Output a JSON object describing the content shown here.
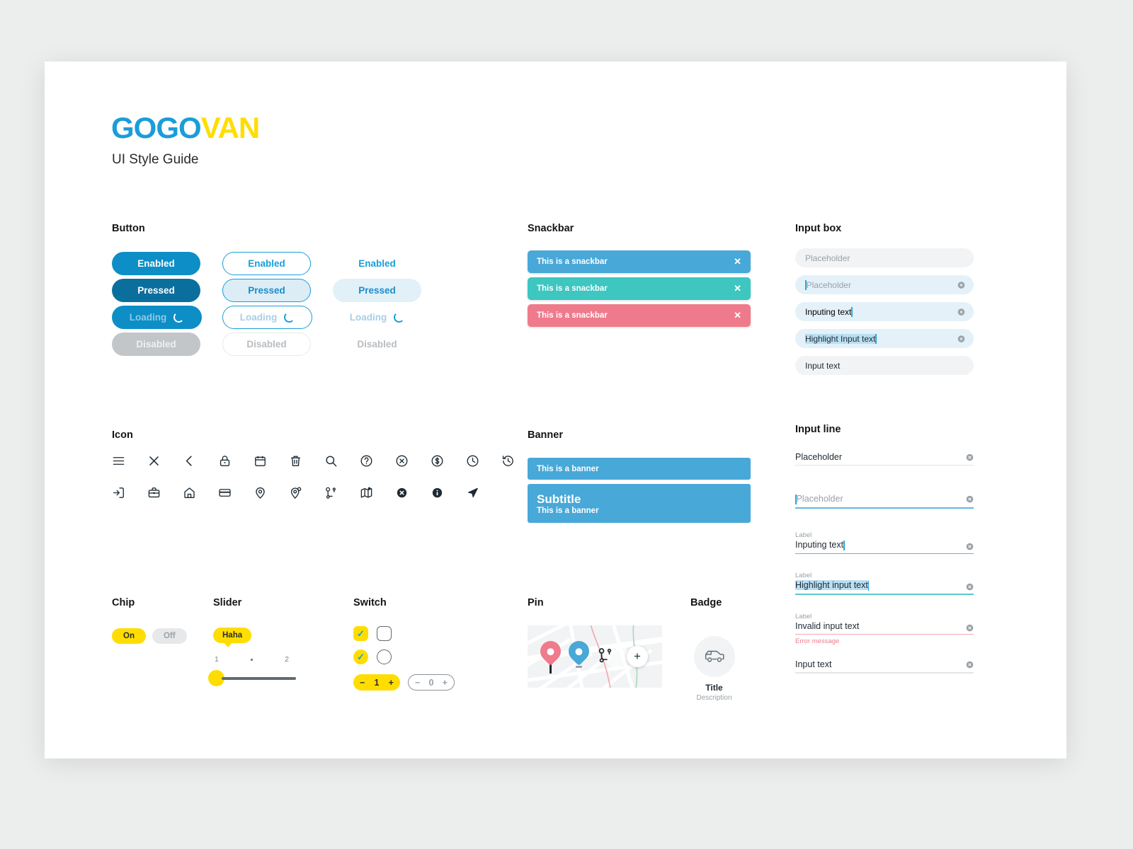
{
  "brand": {
    "part1": "GOGO",
    "part2": "VAN",
    "subtitle": "UI Style Guide",
    "blue": "#1b9dd9",
    "yellow": "#ffdd00"
  },
  "sections": {
    "button": "Button",
    "snackbar": "Snackbar",
    "input_box": "Input box",
    "icon": "Icon",
    "banner": "Banner",
    "input_line": "Input line",
    "chip": "Chip",
    "slider": "Slider",
    "switch": "Switch",
    "pin": "Pin",
    "badge": "Badge"
  },
  "buttons": {
    "states": [
      "Enabled",
      "Pressed",
      "Loading",
      "Disabled"
    ],
    "filled": {
      "enabled": "Enabled",
      "pressed": "Pressed",
      "loading": "Loading",
      "disabled": "Disabled"
    },
    "outline": {
      "enabled": "Enabled",
      "pressed": "Pressed",
      "loading": "Loading",
      "disabled": "Disabled"
    },
    "text": {
      "enabled": "Enabled",
      "pressed": "Pressed",
      "loading": "Loading",
      "disabled": "Disabled"
    }
  },
  "snackbars": [
    {
      "text": "This is a snackbar",
      "color": "#48a8d8",
      "close": "✕"
    },
    {
      "text": "This is a snackbar",
      "color": "#3ec6c0",
      "close": "✕"
    },
    {
      "text": "This is a snackbar",
      "color": "#ef7a8b",
      "close": "✕"
    }
  ],
  "banners": {
    "simple": {
      "text": "This is a banner"
    },
    "with_subtitle": {
      "title": "Subtitle",
      "text": "This is a banner"
    },
    "color": "#48a8d8"
  },
  "input_box": [
    {
      "value": "",
      "placeholder": "Placeholder",
      "state": "default",
      "clear": false
    },
    {
      "value": "",
      "placeholder": "Placeholder",
      "state": "focus",
      "clear": true
    },
    {
      "value": "Inputing text",
      "placeholder": "",
      "state": "typing",
      "clear": true
    },
    {
      "value": "Highlight Input text",
      "placeholder": "",
      "state": "highlight",
      "clear": true
    },
    {
      "value": "Input text",
      "placeholder": "",
      "state": "filled",
      "clear": false
    }
  ],
  "input_line": [
    {
      "label": "",
      "value": "",
      "placeholder": "Placeholder",
      "state": "default",
      "error": ""
    },
    {
      "label": "",
      "value": "",
      "placeholder": "Placeholder",
      "state": "focus",
      "error": ""
    },
    {
      "label": "Label",
      "value": "Inputing text",
      "placeholder": "",
      "state": "typing",
      "error": ""
    },
    {
      "label": "Label",
      "value": "Highlight input text",
      "placeholder": "",
      "state": "highlight",
      "error": ""
    },
    {
      "label": "Label",
      "value": "Invalid input text",
      "placeholder": "",
      "state": "error",
      "error": "Error message"
    },
    {
      "label": "",
      "value": "Input text",
      "placeholder": "",
      "state": "filled",
      "error": ""
    }
  ],
  "icons": {
    "row1": [
      "menu-icon",
      "close-icon",
      "chevron-left-icon",
      "lock-icon",
      "calendar-icon",
      "trash-icon",
      "search-icon",
      "help-circle-icon",
      "close-circle-icon",
      "dollar-circle-icon",
      "clock-icon",
      "history-icon"
    ],
    "row2": [
      "login-icon",
      "briefcase-icon",
      "home-icon",
      "card-icon",
      "pin-icon",
      "pin-search-icon",
      "route-icon",
      "map-icon",
      "close-circle-filled-icon",
      "info-circle-filled-icon",
      "navigation-icon"
    ]
  },
  "chip": {
    "on": "On",
    "off": "Off"
  },
  "slider": {
    "tooltip": "Haha",
    "min_label": "1",
    "max_label": "2",
    "value": 1
  },
  "switch": {
    "checkbox_on": "✓",
    "checkbox_off": "",
    "radio_on": "✓",
    "radio_off": "",
    "stepper_active": {
      "minus": "−",
      "value": "1",
      "plus": "+"
    },
    "stepper_inactive": {
      "minus": "−",
      "value": "0",
      "plus": "+"
    }
  },
  "pin": {
    "pin_pink": "#ef7a8b",
    "pin_blue": "#48a8d8",
    "plus": "+"
  },
  "badge": {
    "title": "Title",
    "description": "Description",
    "icon": "van-icon"
  }
}
